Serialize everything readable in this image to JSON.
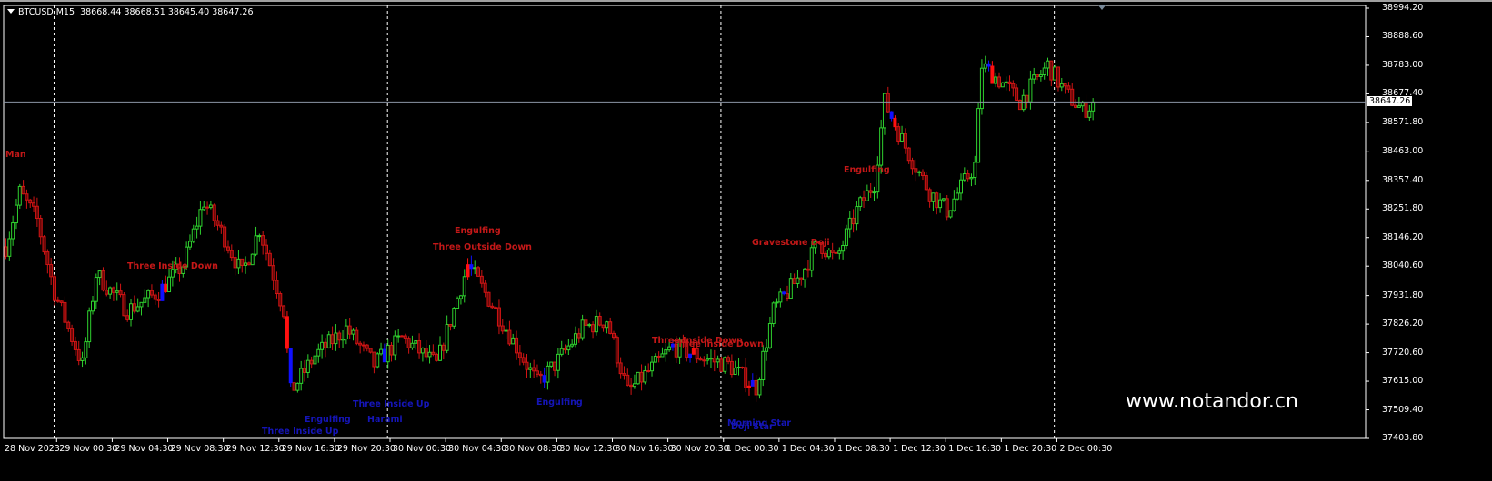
{
  "header": {
    "symbol": "BTCUSD,M15",
    "open": "38668.44",
    "high": "38668.51",
    "low": "38645.40",
    "close": "38647.26"
  },
  "watermark": "www.notandor.cn",
  "current_price_label": "38647.26",
  "colors": {
    "bull": "#2ed12e",
    "bear": "#d01414",
    "pattern_bull": "#1010ff",
    "pattern_bear": "#ff1010",
    "grid": "#ffffff",
    "price_line": "#8c96a6"
  },
  "chart_data": {
    "type": "candlestick",
    "symbol": "BTCUSD",
    "timeframe": "M15",
    "ylim": [
      37403.8,
      38994.2
    ],
    "bar_count": 314,
    "y_ticks": [
      "38994.20",
      "38888.60",
      "38783.00",
      "38677.40",
      "38571.80",
      "38463.00",
      "38357.40",
      "38251.80",
      "38146.20",
      "38040.60",
      "37931.80",
      "37826.20",
      "37720.60",
      "37615.00",
      "37509.40",
      "37403.80"
    ],
    "x_ticks": [
      "28 Nov 2023",
      "29 Nov 00:30",
      "29 Nov 04:30",
      "29 Nov 08:30",
      "29 Nov 12:30",
      "29 Nov 16:30",
      "29 Nov 20:30",
      "30 Nov 00:30",
      "30 Nov 04:30",
      "30 Nov 08:30",
      "30 Nov 12:30",
      "30 Nov 16:30",
      "30 Nov 20:30",
      "1 Dec 00:30",
      "1 Dec 04:30",
      "1 Dec 08:30",
      "1 Dec 12:30",
      "1 Dec 16:30",
      "1 Dec 20:30",
      "2 Dec 00:30"
    ],
    "day_separator_bars": [
      14,
      110,
      206,
      302
    ],
    "close_anchors": [
      [
        0,
        38112
      ],
      [
        4,
        38313
      ],
      [
        9,
        38212
      ],
      [
        14,
        37944
      ],
      [
        22,
        37676
      ],
      [
        26,
        38011
      ],
      [
        35,
        37877
      ],
      [
        44,
        37944
      ],
      [
        51,
        38045
      ],
      [
        57,
        38280
      ],
      [
        63,
        38145
      ],
      [
        68,
        38011
      ],
      [
        73,
        38179
      ],
      [
        80,
        37877
      ],
      [
        82,
        37575
      ],
      [
        89,
        37709
      ],
      [
        98,
        37810
      ],
      [
        106,
        37676
      ],
      [
        114,
        37776
      ],
      [
        124,
        37676
      ],
      [
        133,
        38045
      ],
      [
        141,
        37877
      ],
      [
        153,
        37608
      ],
      [
        158,
        37676
      ],
      [
        166,
        37810
      ],
      [
        173,
        37843
      ],
      [
        179,
        37575
      ],
      [
        187,
        37676
      ],
      [
        192,
        37743
      ],
      [
        203,
        37692
      ],
      [
        208,
        37676
      ],
      [
        216,
        37592
      ],
      [
        221,
        37877
      ],
      [
        229,
        38011
      ],
      [
        234,
        38129
      ],
      [
        239,
        38062
      ],
      [
        245,
        38246
      ],
      [
        250,
        38347
      ],
      [
        253,
        38649
      ],
      [
        259,
        38481
      ],
      [
        266,
        38313
      ],
      [
        271,
        38246
      ],
      [
        279,
        38414
      ],
      [
        281,
        38783
      ],
      [
        287,
        38716
      ],
      [
        292,
        38649
      ],
      [
        300,
        38783
      ],
      [
        305,
        38682
      ],
      [
        310,
        38615
      ],
      [
        314,
        38647.26
      ]
    ],
    "patterns": [
      {
        "text": "Man",
        "kind": "bear"
      },
      {
        "text": "Three Inside Down",
        "kind": "bear"
      },
      {
        "text": "Engulfing",
        "kind": "bear"
      },
      {
        "text": "Three Outside Down",
        "kind": "bear"
      },
      {
        "text": "Three Inside Up",
        "kind": "bull"
      },
      {
        "text": "Engulfing",
        "kind": "bull"
      },
      {
        "text": "Three Inside Up",
        "kind": "bull"
      },
      {
        "text": "Harami",
        "kind": "bull"
      },
      {
        "text": "Engulfing",
        "kind": "bull"
      },
      {
        "text": "Three Inside Down",
        "kind": "bear"
      },
      {
        "text": "Three Inside Down",
        "kind": "bear"
      },
      {
        "text": "Morning Star",
        "kind": "bull"
      },
      {
        "text": "Doji Star",
        "kind": "bull"
      },
      {
        "text": "Gravestone Doji",
        "kind": "bear"
      },
      {
        "text": "Engulfing",
        "kind": "bear"
      }
    ],
    "pattern_bars": {
      "blue": [
        45,
        82,
        109,
        134,
        155,
        192,
        197,
        215,
        224,
        255,
        283
      ],
      "red": [
        46,
        81,
        133,
        198,
        214,
        256,
        284
      ]
    }
  }
}
